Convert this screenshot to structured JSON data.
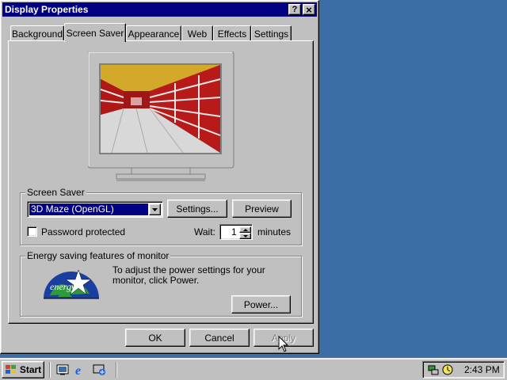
{
  "window": {
    "title": "Display Properties",
    "help_btn": "?",
    "close_btn": "×"
  },
  "tabs": [
    "Background",
    "Screen Saver",
    "Appearance",
    "Web",
    "Effects",
    "Settings"
  ],
  "active_tab": 1,
  "screen_saver": {
    "group_label": "Screen Saver",
    "selected": "3D Maze (OpenGL)",
    "settings_label": "Settings...",
    "preview_label": "Preview",
    "password_label": "Password protected",
    "password_checked": false,
    "wait_label": "Wait:",
    "wait_value": "1",
    "minutes_label": "minutes"
  },
  "energy": {
    "group_label": "Energy saving features of monitor",
    "text": "To adjust the power settings for your monitor, click Power.",
    "power_label": "Power...",
    "logo_text": "energy"
  },
  "buttons": {
    "ok": "OK",
    "cancel": "Cancel",
    "apply": "Apply"
  },
  "taskbar": {
    "start_label": "Start",
    "clock": "2:43 PM"
  },
  "colors": {
    "titlebar": "#000080",
    "desktop": "#3a6ea5",
    "face": "#c0c0c0",
    "select": "#000080"
  }
}
